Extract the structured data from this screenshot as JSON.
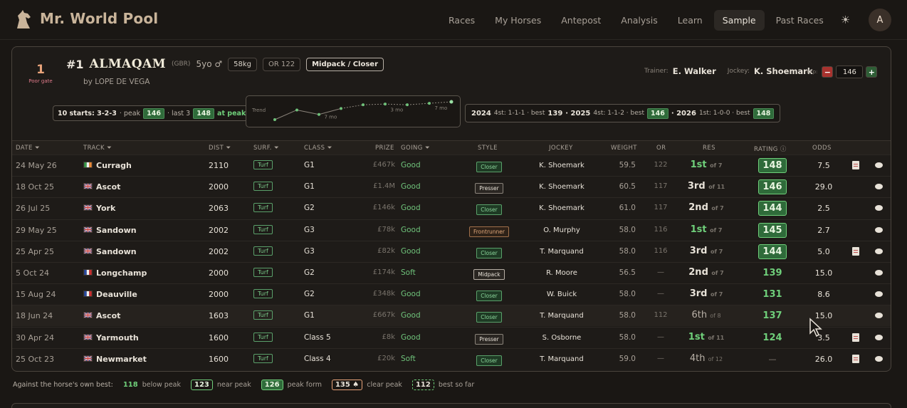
{
  "nav": {
    "brand": "Mr. World Pool",
    "links": [
      "Races",
      "My Horses",
      "Antepost",
      "Analysis",
      "Learn",
      "Sample",
      "Past Races"
    ],
    "active": "Sample",
    "theme_icon": "sun-icon",
    "avatar_letter": "A"
  },
  "horse": {
    "gate_number": "1",
    "gate_label": "Poor gate",
    "number": "#1",
    "name": "ALMAQAM",
    "country": "(GBR)",
    "age_sex": "5yo ♂",
    "weight": "58kg",
    "or": "OR 122",
    "style": "Midpack / Closer",
    "sire": "by LOPE DE VEGA",
    "trainer_label": "Trainer:",
    "trainer": "E. Walker",
    "jockey_label": "Jockey:",
    "jockey": "K. Shoemark",
    "exp_label": "Exp:",
    "exp_value": "146",
    "minus": "−",
    "plus": "+"
  },
  "summary": {
    "starts": "10 starts: 3-2-3",
    "peak_label": "· peak",
    "peak": "146",
    "last3_label": "· last 3",
    "last3": "148",
    "at_peak": "at peak"
  },
  "trend": {
    "label": "Trend",
    "gap_labels": [
      "7 mo",
      "3 mo",
      "7 mo"
    ],
    "values": [
      124,
      137,
      131,
      139,
      144,
      145,
      144,
      146,
      148
    ]
  },
  "years": [
    {
      "year": "2024",
      "text": "4st: 1-1-1 · best",
      "best": "139",
      "badge": false
    },
    {
      "year": "· 2025",
      "text": "4st: 1-1-2 · best",
      "best": "146",
      "badge": true
    },
    {
      "year": "· 2026",
      "text": "1st: 1-0-0 · best",
      "best": "148",
      "badge": true
    }
  ],
  "columns": {
    "date": "DATE",
    "track": "TRACK",
    "dist": "DIST",
    "surf": "SURF.",
    "class": "CLASS",
    "prize": "PRIZE",
    "going": "GOING",
    "style": "STYLE",
    "jockey": "JOCKEY",
    "weight": "WEIGHT",
    "or": "OR",
    "res": "RES",
    "rating": "RATING",
    "odds": "ODDS"
  },
  "runs": [
    {
      "date": "24 May 26",
      "flag": "ireland",
      "track": "Curragh",
      "dist": "2110",
      "surf": "Turf",
      "class": "G1",
      "prize": "£467k",
      "going": "Good",
      "style": "Closer",
      "jockey": "K. Shoemark",
      "weight": "59.5",
      "or": "122",
      "pos": "1st",
      "of": "of 7",
      "rating": "148",
      "rtype": "badge",
      "odds": "7.5",
      "doc": true
    },
    {
      "date": "18 Oct 25",
      "flag": "uk",
      "track": "Ascot",
      "dist": "2000",
      "surf": "Turf",
      "class": "G1",
      "prize": "£1.4M",
      "going": "Good",
      "style": "Presser",
      "jockey": "K. Shoemark",
      "weight": "60.5",
      "or": "117",
      "pos": "3rd",
      "of": "of 11",
      "rating": "146",
      "rtype": "badge",
      "odds": "29.0",
      "doc": false
    },
    {
      "date": "26 Jul 25",
      "flag": "uk",
      "track": "York",
      "dist": "2063",
      "surf": "Turf",
      "class": "G2",
      "prize": "£146k",
      "going": "Good",
      "style": "Closer",
      "jockey": "K. Shoemark",
      "weight": "61.0",
      "or": "117",
      "pos": "2nd",
      "of": "of 7",
      "rating": "144",
      "rtype": "badge",
      "odds": "2.5",
      "doc": false
    },
    {
      "date": "29 May 25",
      "flag": "uk",
      "track": "Sandown",
      "dist": "2002",
      "surf": "Turf",
      "class": "G3",
      "prize": "£78k",
      "going": "Good",
      "style": "Frontrunner",
      "jockey": "O. Murphy",
      "weight": "58.0",
      "or": "116",
      "pos": "1st",
      "of": "of 7",
      "rating": "145",
      "rtype": "badge",
      "odds": "2.7",
      "doc": false
    },
    {
      "date": "25 Apr 25",
      "flag": "uk",
      "track": "Sandown",
      "dist": "2002",
      "surf": "Turf",
      "class": "G3",
      "prize": "£82k",
      "going": "Good",
      "style": "Closer",
      "jockey": "T. Marquand",
      "weight": "58.0",
      "or": "116",
      "pos": "3rd",
      "of": "of 7",
      "rating": "144",
      "rtype": "badge",
      "odds": "5.0",
      "doc": true
    },
    {
      "date": "5 Oct 24",
      "flag": "france",
      "track": "Longchamp",
      "dist": "2000",
      "surf": "Turf",
      "class": "G2",
      "prize": "£174k",
      "going": "Soft",
      "style": "Midpack",
      "jockey": "R. Moore",
      "weight": "56.5",
      "or": "—",
      "pos": "2nd",
      "of": "of 7",
      "rating": "139",
      "rtype": "plain",
      "odds": "15.0",
      "doc": false
    },
    {
      "date": "15 Aug 24",
      "flag": "france",
      "track": "Deauville",
      "dist": "2000",
      "surf": "Turf",
      "class": "G2",
      "prize": "£348k",
      "going": "Good",
      "style": "Closer",
      "jockey": "W. Buick",
      "weight": "58.0",
      "or": "—",
      "pos": "3rd",
      "of": "of 7",
      "rating": "131",
      "rtype": "plain",
      "odds": "8.6",
      "doc": false
    },
    {
      "date": "18 Jun 24",
      "flag": "uk",
      "track": "Ascot",
      "dist": "1603",
      "surf": "Turf",
      "class": "G1",
      "prize": "£667k",
      "going": "Good",
      "style": "Closer",
      "jockey": "T. Marquand",
      "weight": "58.0",
      "or": "112",
      "pos": "6th",
      "of": "of 8",
      "rating": "137",
      "rtype": "plain",
      "odds": "15.0",
      "doc": false
    },
    {
      "date": "30 Apr 24",
      "flag": "uk",
      "track": "Yarmouth",
      "dist": "1600",
      "surf": "Turf",
      "class": "Class 5",
      "prize": "£8k",
      "going": "Good",
      "style": "Presser",
      "jockey": "S. Osborne",
      "weight": "58.0",
      "or": "—",
      "pos": "1st",
      "of": "of 11",
      "rating": "124",
      "rtype": "plain",
      "odds": "3.5",
      "doc": true
    },
    {
      "date": "25 Oct 23",
      "flag": "uk",
      "track": "Newmarket",
      "dist": "1600",
      "surf": "Turf",
      "class": "Class 4",
      "prize": "£20k",
      "going": "Soft",
      "style": "Closer",
      "jockey": "T. Marquand",
      "weight": "59.0",
      "or": "—",
      "pos": "4th",
      "of": "of 12",
      "rating": "—",
      "rtype": "dash",
      "odds": "26.0",
      "doc": true
    }
  ],
  "legend": {
    "title": "Against the horse's own best:",
    "items": [
      {
        "value": "118",
        "label": "below peak",
        "kind": "below"
      },
      {
        "value": "123",
        "label": "near peak",
        "kind": "near"
      },
      {
        "value": "126",
        "label": "peak form",
        "kind": "peak"
      },
      {
        "value": "135 ♠",
        "label": "clear peak",
        "kind": "clear"
      },
      {
        "value": "112",
        "label": "best so far",
        "kind": "best"
      }
    ]
  },
  "colors": {
    "accent_green": "#6fcf7a",
    "badge_green": "#2f6b3a",
    "brand": "#c9b49a",
    "gate_orange": "#e8a37a"
  }
}
